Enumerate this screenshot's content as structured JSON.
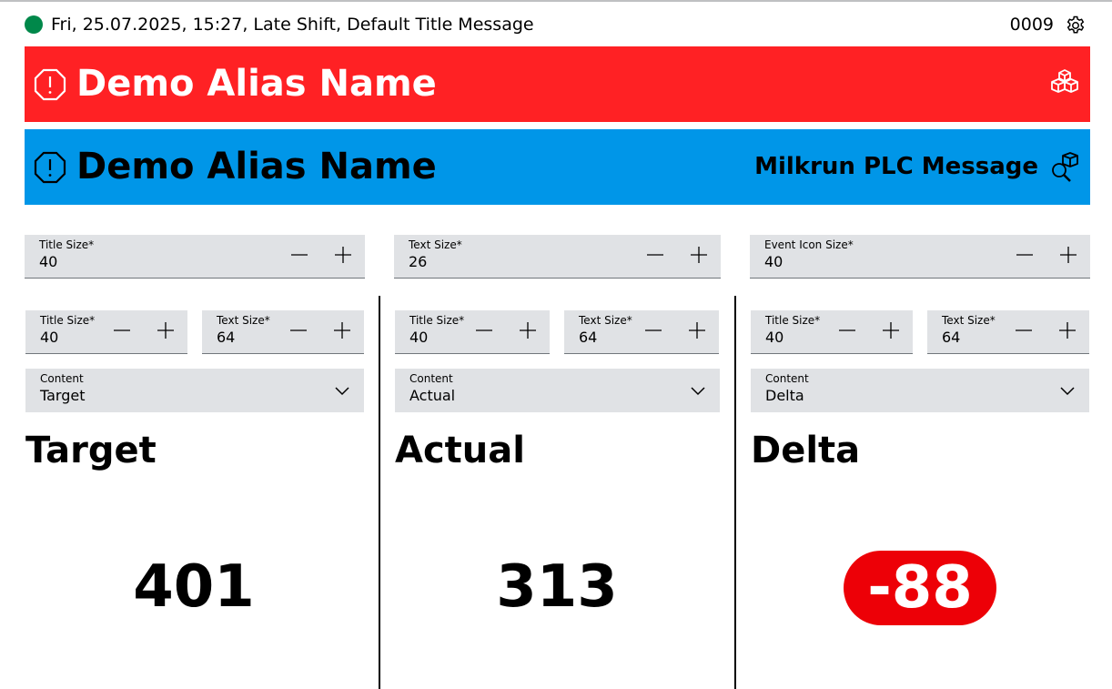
{
  "status": {
    "text": "Fri, 25.07.2025, 15:27, Late Shift, Default Title Message",
    "count": "0009",
    "dot_color": "#00884a"
  },
  "banners": [
    {
      "title": "Demo Alias Name",
      "message": "",
      "color": "#ff2124",
      "icon": "alert-octagon-icon",
      "right_icon": "boxes-icon"
    },
    {
      "title": "Demo Alias Name",
      "message": "Milkrun PLC Message",
      "color": "#0096e8",
      "icon": "alert-octagon-icon",
      "right_icon": "box-search-icon"
    }
  ],
  "settings": {
    "title_size": {
      "label": "Title Size*",
      "value": "40"
    },
    "text_size": {
      "label": "Text Size*",
      "value": "26"
    },
    "event_icon_size": {
      "label": "Event Icon Size*",
      "value": "40"
    }
  },
  "columns": [
    {
      "title_size": {
        "label": "Title Size*",
        "value": "40"
      },
      "text_size": {
        "label": "Text Size*",
        "value": "64"
      },
      "content": {
        "label": "Content",
        "value": "Target"
      },
      "title": "Target",
      "value": "401"
    },
    {
      "title_size": {
        "label": "Title Size*",
        "value": "40"
      },
      "text_size": {
        "label": "Text Size*",
        "value": "64"
      },
      "content": {
        "label": "Content",
        "value": "Actual"
      },
      "title": "Actual",
      "value": "313"
    },
    {
      "title_size": {
        "label": "Title Size*",
        "value": "40"
      },
      "text_size": {
        "label": "Text Size*",
        "value": "64"
      },
      "content": {
        "label": "Content",
        "value": "Delta"
      },
      "title": "Delta",
      "value": "-88",
      "badge_color": "#ed0007"
    }
  ]
}
